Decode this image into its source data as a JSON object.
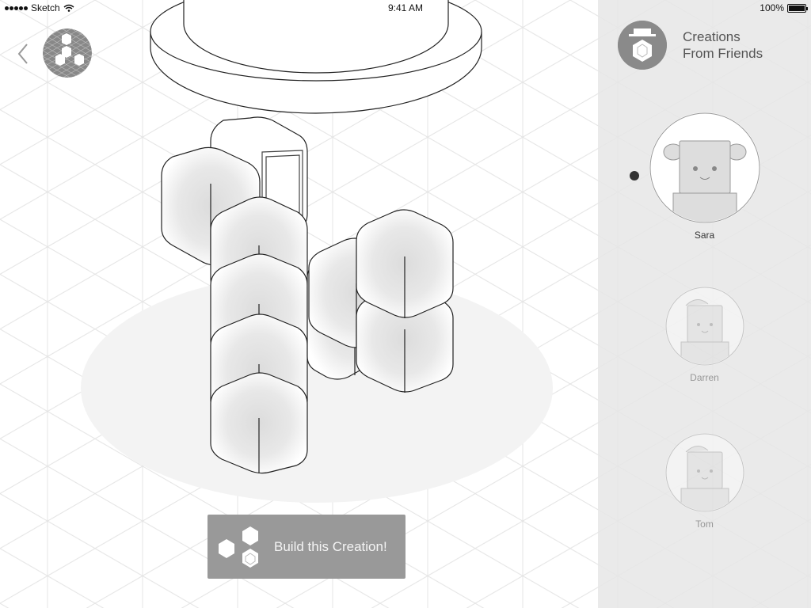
{
  "status_bar": {
    "carrier": "Sketch",
    "time": "9:41 AM",
    "battery": "100%"
  },
  "panel": {
    "title_line1": "Creations",
    "title_line2": "From Friends"
  },
  "friends": [
    {
      "name": "Sara",
      "selected": true
    },
    {
      "name": "Darren",
      "selected": false
    },
    {
      "name": "Tom",
      "selected": false
    }
  ],
  "build_button": {
    "label": "Build this Creation!"
  },
  "icons": {
    "back": "chevron-left-icon",
    "wifi": "wifi-icon",
    "battery": "battery-icon",
    "signal": "signal-dots-icon"
  }
}
